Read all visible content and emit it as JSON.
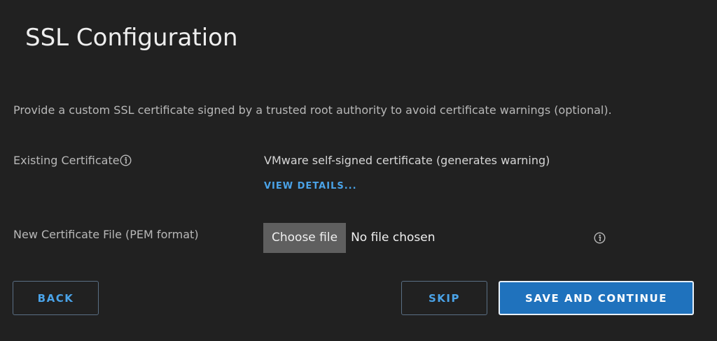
{
  "page": {
    "title": "SSL Configuration",
    "description": "Provide a custom SSL certificate signed by a trusted root authority to avoid certificate warnings (optional)."
  },
  "existing_certificate": {
    "label": "Existing Certificate",
    "value": "VMware self-signed certificate (generates warning)",
    "view_details_label": "VIEW DETAILS...",
    "info_icon": "info-icon"
  },
  "new_certificate": {
    "label": "New Certificate File (PEM format)",
    "choose_file_label": "Choose file",
    "file_status": "No file chosen",
    "info_icon": "info-icon"
  },
  "actions": {
    "back_label": "BACK",
    "skip_label": "SKIP",
    "save_label": "SAVE AND CONTINUE"
  },
  "colors": {
    "background": "#212121",
    "accent": "#4aa3e8",
    "primary_button": "#1f72bd"
  }
}
